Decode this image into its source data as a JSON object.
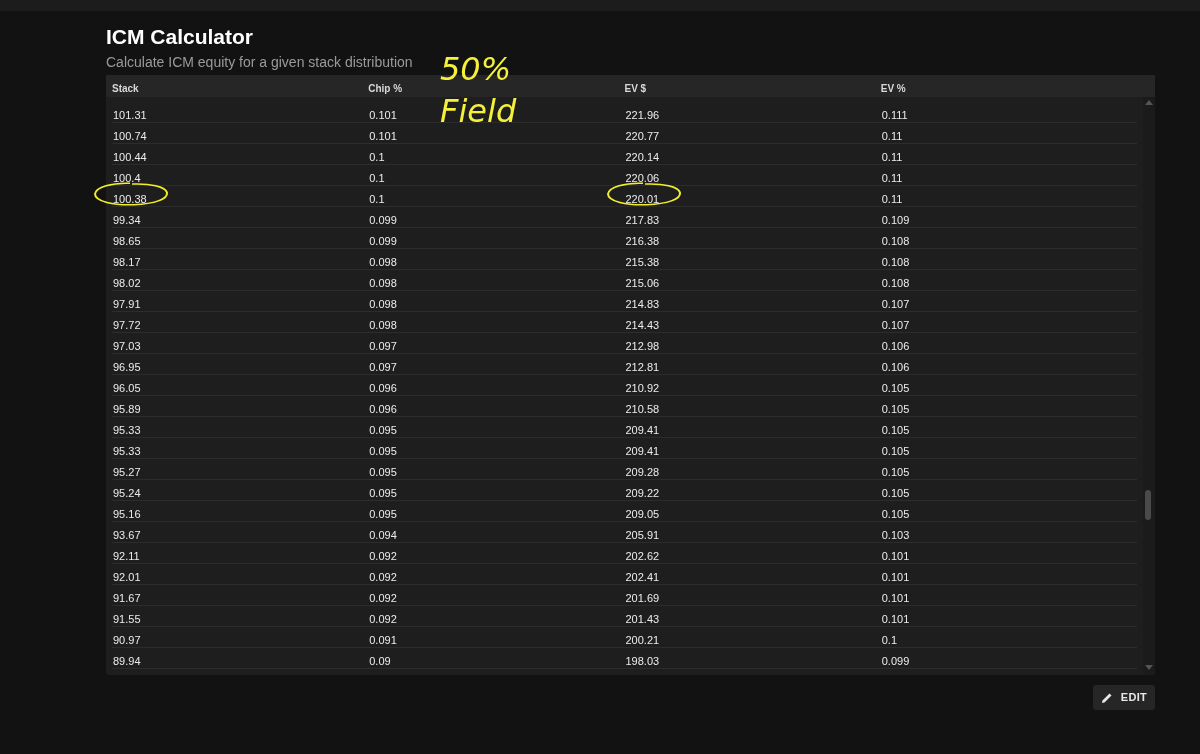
{
  "page": {
    "title": "ICM Calculator",
    "subtitle": "Calculate ICM equity for a given stack distribution"
  },
  "table": {
    "columns": [
      "Stack",
      "Chip %",
      "EV $",
      "EV %"
    ],
    "rows": [
      {
        "cells": [
          "101.31",
          "0.101",
          "221.96",
          "0.111"
        ],
        "circled_stack": false,
        "circled_ev": false
      },
      {
        "cells": [
          "100.74",
          "0.101",
          "220.77",
          "0.11"
        ],
        "circled_stack": false,
        "circled_ev": false
      },
      {
        "cells": [
          "100.44",
          "0.1",
          "220.14",
          "0.11"
        ],
        "circled_stack": false,
        "circled_ev": false
      },
      {
        "cells": [
          "100.4",
          "0.1",
          "220.06",
          "0.11"
        ],
        "circled_stack": false,
        "circled_ev": false
      },
      {
        "cells": [
          "100.38",
          "0.1",
          "220.01",
          "0.11"
        ],
        "circled_stack": true,
        "circled_ev": true
      },
      {
        "cells": [
          "99.34",
          "0.099",
          "217.83",
          "0.109"
        ],
        "circled_stack": false,
        "circled_ev": false
      },
      {
        "cells": [
          "98.65",
          "0.099",
          "216.38",
          "0.108"
        ],
        "circled_stack": false,
        "circled_ev": false
      },
      {
        "cells": [
          "98.17",
          "0.098",
          "215.38",
          "0.108"
        ],
        "circled_stack": false,
        "circled_ev": false
      },
      {
        "cells": [
          "98.02",
          "0.098",
          "215.06",
          "0.108"
        ],
        "circled_stack": false,
        "circled_ev": false
      },
      {
        "cells": [
          "97.91",
          "0.098",
          "214.83",
          "0.107"
        ],
        "circled_stack": false,
        "circled_ev": false
      },
      {
        "cells": [
          "97.72",
          "0.098",
          "214.43",
          "0.107"
        ],
        "circled_stack": false,
        "circled_ev": false
      },
      {
        "cells": [
          "97.03",
          "0.097",
          "212.98",
          "0.106"
        ],
        "circled_stack": false,
        "circled_ev": false
      },
      {
        "cells": [
          "96.95",
          "0.097",
          "212.81",
          "0.106"
        ],
        "circled_stack": false,
        "circled_ev": false
      },
      {
        "cells": [
          "96.05",
          "0.096",
          "210.92",
          "0.105"
        ],
        "circled_stack": false,
        "circled_ev": false
      },
      {
        "cells": [
          "95.89",
          "0.096",
          "210.58",
          "0.105"
        ],
        "circled_stack": false,
        "circled_ev": false
      },
      {
        "cells": [
          "95.33",
          "0.095",
          "209.41",
          "0.105"
        ],
        "circled_stack": false,
        "circled_ev": false
      },
      {
        "cells": [
          "95.33",
          "0.095",
          "209.41",
          "0.105"
        ],
        "circled_stack": false,
        "circled_ev": false
      },
      {
        "cells": [
          "95.27",
          "0.095",
          "209.28",
          "0.105"
        ],
        "circled_stack": false,
        "circled_ev": false
      },
      {
        "cells": [
          "95.24",
          "0.095",
          "209.22",
          "0.105"
        ],
        "circled_stack": false,
        "circled_ev": false
      },
      {
        "cells": [
          "95.16",
          "0.095",
          "209.05",
          "0.105"
        ],
        "circled_stack": false,
        "circled_ev": false
      },
      {
        "cells": [
          "93.67",
          "0.094",
          "205.91",
          "0.103"
        ],
        "circled_stack": false,
        "circled_ev": false
      },
      {
        "cells": [
          "92.11",
          "0.092",
          "202.62",
          "0.101"
        ],
        "circled_stack": false,
        "circled_ev": false
      },
      {
        "cells": [
          "92.01",
          "0.092",
          "202.41",
          "0.101"
        ],
        "circled_stack": false,
        "circled_ev": false
      },
      {
        "cells": [
          "91.67",
          "0.092",
          "201.69",
          "0.101"
        ],
        "circled_stack": false,
        "circled_ev": false
      },
      {
        "cells": [
          "91.55",
          "0.092",
          "201.43",
          "0.101"
        ],
        "circled_stack": false,
        "circled_ev": false
      },
      {
        "cells": [
          "90.97",
          "0.091",
          "200.21",
          "0.1"
        ],
        "circled_stack": false,
        "circled_ev": false
      },
      {
        "cells": [
          "89.94",
          "0.09",
          "198.03",
          "0.099"
        ],
        "circled_stack": false,
        "circled_ev": false
      }
    ]
  },
  "handwritten_note": [
    "50%",
    "Field"
  ],
  "edit_button": {
    "label": "EDIT"
  }
}
